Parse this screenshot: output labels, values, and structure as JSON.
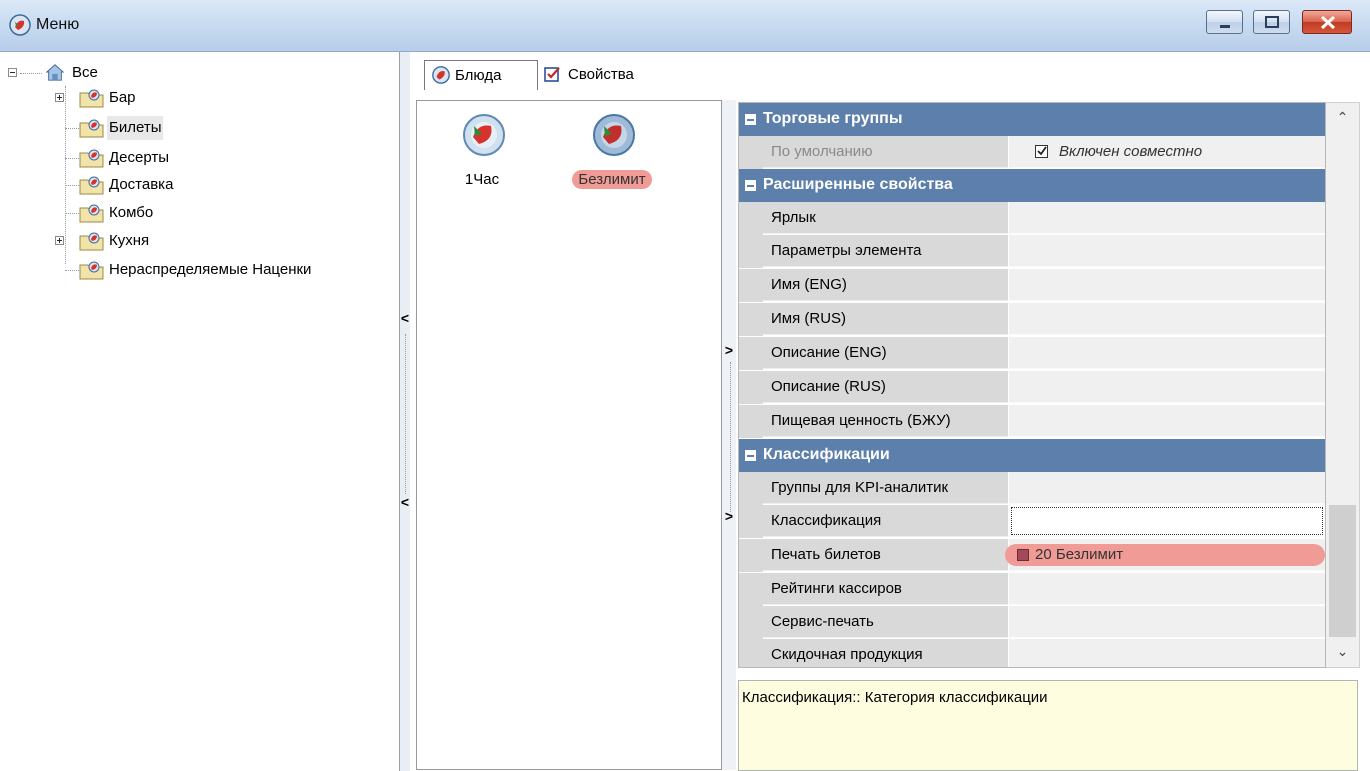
{
  "window": {
    "title": "Меню",
    "minimize_icon": "minimize-icon",
    "maximize_icon": "maximize-icon",
    "close_icon": "close-icon"
  },
  "tree": {
    "root": "Все",
    "items": [
      {
        "label": "Бар",
        "expandable": true
      },
      {
        "label": "Билеты",
        "expandable": false,
        "selected": true
      },
      {
        "label": "Десерты",
        "expandable": false
      },
      {
        "label": "Доставка",
        "expandable": false
      },
      {
        "label": "Комбо",
        "expandable": false
      },
      {
        "label": "Кухня",
        "expandable": true
      },
      {
        "label": "Нераспределяемые Наценки",
        "expandable": false
      }
    ]
  },
  "tabs": [
    {
      "label": "Блюда",
      "icon": "dish-plate-icon",
      "active": true
    },
    {
      "label": "Свойства",
      "icon": "checkbox-icon",
      "active": false
    }
  ],
  "dishes": [
    {
      "label": "1Час",
      "selected": false
    },
    {
      "label": "Безлимит",
      "selected": true
    }
  ],
  "properties": {
    "categories": [
      {
        "title": "Торговые группы"
      },
      {
        "title": "Расширенные свойства"
      },
      {
        "title": "Классификации"
      }
    ],
    "rows": {
      "default": {
        "name": "По умолчанию",
        "value": "Включен совместно",
        "checked": true
      },
      "label": {
        "name": "Ярлык",
        "value": ""
      },
      "params": {
        "name": "Параметры элемента",
        "value": ""
      },
      "name_eng": {
        "name": "Имя (ENG)",
        "value": ""
      },
      "name_rus": {
        "name": "Имя (RUS)",
        "value": ""
      },
      "desc_eng": {
        "name": "Описание (ENG)",
        "value": ""
      },
      "desc_rus": {
        "name": "Описание (RUS)",
        "value": ""
      },
      "nutrition": {
        "name": "Пищевая ценность (БЖУ)",
        "value": ""
      },
      "kpi": {
        "name": "Группы для KPI-аналитик",
        "value": ""
      },
      "classification": {
        "name": "Классификация",
        "value": ""
      },
      "ticket_print": {
        "name": "Печать билетов",
        "value": "20 Безлимит"
      },
      "cashier_rating": {
        "name": "Рейтинги кассиров",
        "value": ""
      },
      "service_print": {
        "name": "Сервис-печать",
        "value": ""
      },
      "discount_products": {
        "name": "Скидочная продукция",
        "value": ""
      }
    }
  },
  "description": "Классификация:: Категория классификации",
  "colors": {
    "category_header": "#5c7fab",
    "highlight_pill": "#f09b96",
    "description_bg": "#fffde0"
  }
}
